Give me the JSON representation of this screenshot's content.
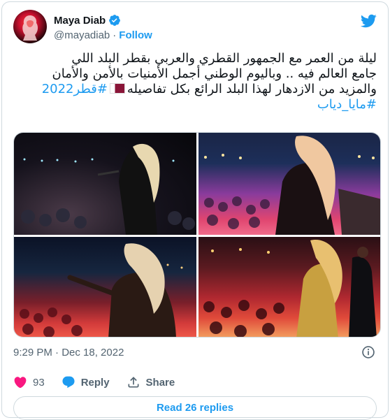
{
  "author": {
    "name": "Maya Diab",
    "handle": "@mayadiab",
    "follow_label": "Follow",
    "avatar_icon": "profile-avatar",
    "verified_icon": "verified-badge-icon"
  },
  "tweet": {
    "line1": "ليلة من العمر مع الجمهور القطري والعربي بقطر البلد اللي",
    "line2": "جامع العالم فيه .. وباليوم الوطني أجمل الأمنيات بالأمن والأمان",
    "line3_text": "والمزيد من الازدهار لهذا البلد الرائع بكل تفاصيله",
    "line3_hashtag": "#قطر2022",
    "line4_hashtag": "#مايا_دياب",
    "flag_icon": "qatar-flag-emoji"
  },
  "media": {
    "photos": [
      {
        "alt_icon": "concert-photo-1"
      },
      {
        "alt_icon": "concert-photo-2"
      },
      {
        "alt_icon": "concert-photo-3"
      },
      {
        "alt_icon": "concert-photo-4"
      }
    ]
  },
  "meta": {
    "timestamp": "9:29 PM · Dec 18, 2022"
  },
  "actions": {
    "like_count": "93",
    "reply_label": "Reply",
    "share_label": "Share"
  },
  "read_replies_label": "Read 26 replies",
  "colors": {
    "accent": "#1d9bf0",
    "like": "#f91880",
    "text": "#0f1419",
    "muted": "#536471",
    "border": "#cfd9de"
  }
}
